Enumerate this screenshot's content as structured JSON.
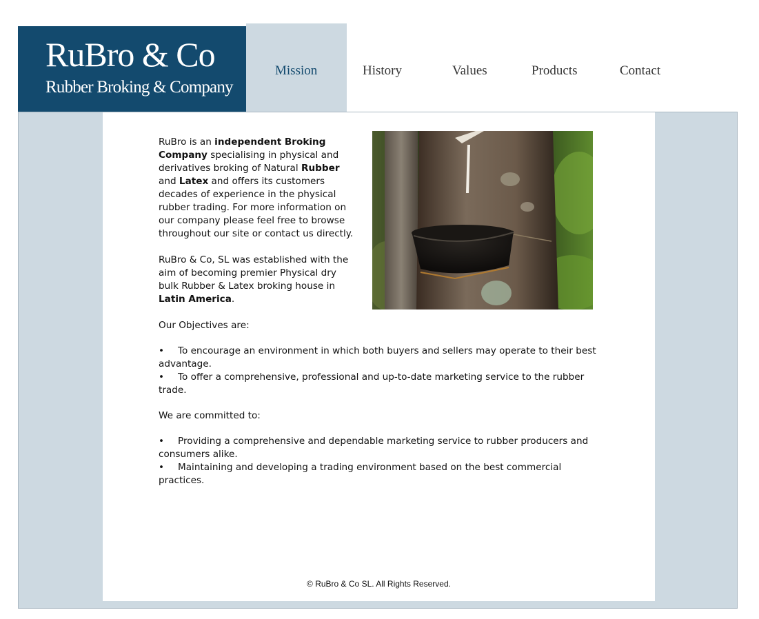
{
  "logo": {
    "main": "RuBro & Co",
    "sub": "Rubber Broking & Company"
  },
  "nav": {
    "items": [
      {
        "label": "Mission",
        "active": true
      },
      {
        "label": "History",
        "active": false
      },
      {
        "label": "Values",
        "active": false
      },
      {
        "label": "Products",
        "active": false
      },
      {
        "label": "Contact",
        "active": false
      }
    ]
  },
  "intro": {
    "p1": {
      "t1": "RuBro is an ",
      "b1": "independent Broking Company",
      "t2": " specialising in physical and derivatives broking of Natural ",
      "b2": "Rubber",
      "t3": " and ",
      "b3": "Latex",
      "t4": " and offers its customers decades of experience in the physical rubber trading. For more information on our company please feel free to browse throughout our site or contact us directly."
    },
    "p2": {
      "t1": "RuBro & Co, SL was established with the aim of becoming premier Physical dry bulk Rubber & Latex broking house in ",
      "b1": "Latin America",
      "t2": "."
    }
  },
  "objectives": {
    "heading": "Our Objectives are:",
    "items": [
      "To encourage an environment in which both buyers and sellers may operate to their best advantage.",
      "To offer a comprehensive, professional and up-to-date marketing service to the rubber trade."
    ]
  },
  "commitments": {
    "heading": "We are committed to:",
    "items": [
      "Providing a comprehensive and dependable marketing service to rubber producers and consumers alike.",
      "Maintaining and developing a trading environment based on the best commercial practices."
    ]
  },
  "bullet": "•",
  "footer": "© RuBro & Co SL. All Rights Reserved.",
  "colors": {
    "brand": "#134a6e",
    "panel": "#cdd9e1"
  }
}
